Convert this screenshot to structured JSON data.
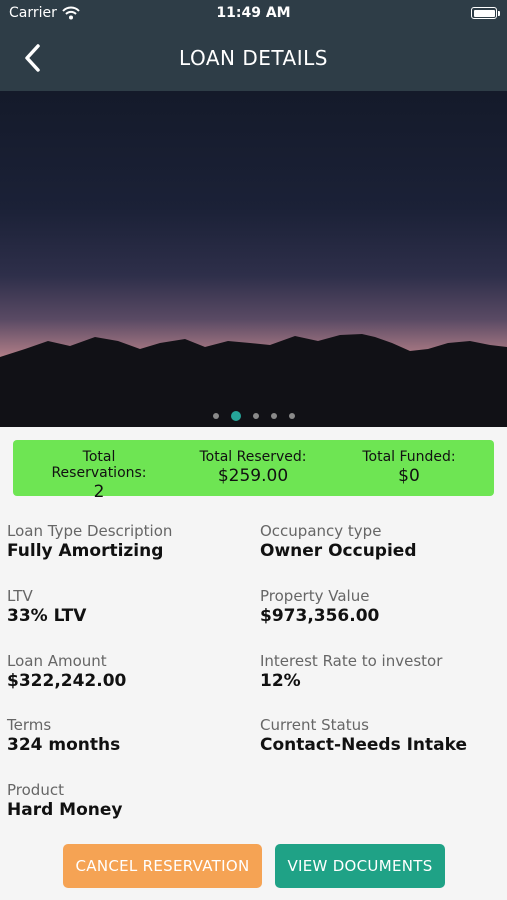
{
  "status_bar": {
    "carrier": "Carrier",
    "time": "11:49 AM"
  },
  "nav": {
    "title": "LOAN DETAILS"
  },
  "carousel": {
    "page_count": 5,
    "active_index": 1
  },
  "summary": {
    "reservations_label": "Total Reservations:",
    "reservations_value": "2",
    "reserved_label": "Total Reserved:",
    "reserved_value": "$259.00",
    "funded_label": "Total Funded:",
    "funded_value": "$0"
  },
  "details": {
    "loan_type": {
      "label": "Loan Type Description",
      "value": "Fully Amortizing"
    },
    "occupancy": {
      "label": "Occupancy type",
      "value": "Owner Occupied"
    },
    "ltv": {
      "label": "LTV",
      "value": "33% LTV"
    },
    "property_value": {
      "label": "Property Value",
      "value": "$973,356.00"
    },
    "loan_amount": {
      "label": "Loan Amount",
      "value": "$322,242.00"
    },
    "interest_rate": {
      "label": "Interest Rate to investor",
      "value": "12%"
    },
    "terms": {
      "label": "Terms",
      "value": "324 months"
    },
    "current_status": {
      "label": "Current Status",
      "value": "Contact-Needs Intake"
    },
    "product": {
      "label": "Product",
      "value": "Hard Money"
    }
  },
  "actions": {
    "cancel_label": "CANCEL RESERVATION",
    "documents_label": "VIEW DOCUMENTS"
  },
  "colors": {
    "nav": "#2e3d47",
    "summary": "#6ee553",
    "cancel": "#f5a354",
    "documents": "#1fa286",
    "active_dot": "#26a69a"
  }
}
